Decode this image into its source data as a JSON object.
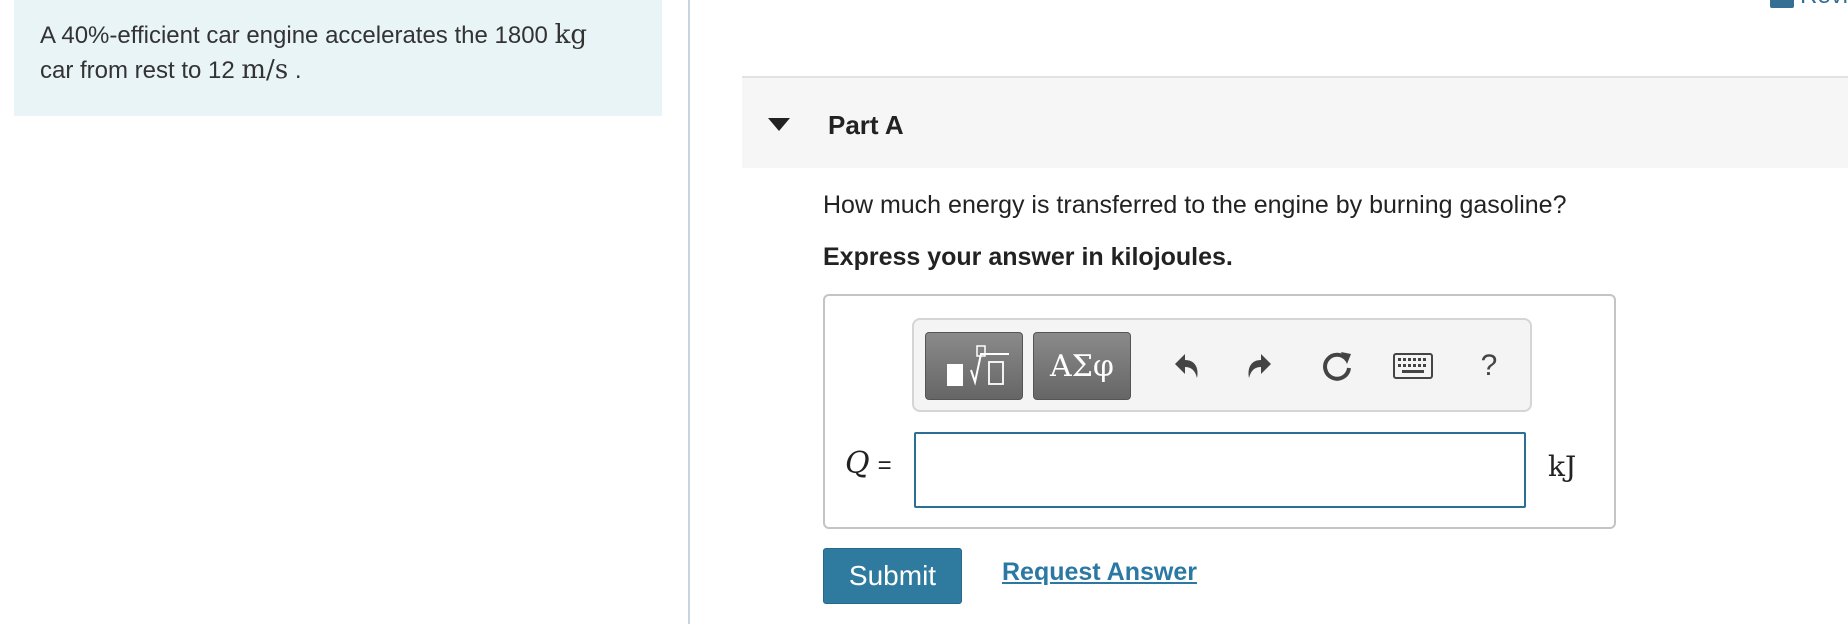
{
  "problem": {
    "text_1": "A 40%-efficient car engine accelerates the 1800 ",
    "mass_unit": "kg",
    "text_2": "car from rest to 12 ",
    "speed_unit": "m/s",
    "text_3": " ."
  },
  "header": {
    "review_label": "Revi"
  },
  "part": {
    "title": "Part A",
    "question": "How much energy is transferred to the engine by burning gasoline?",
    "instruction": "Express your answer in kilojoules."
  },
  "toolbar": {
    "templates_label": "templates",
    "greek_label": "ΑΣφ",
    "help_label": "?"
  },
  "answer": {
    "variable": "Q",
    "equals": "=",
    "value": "",
    "unit": "kJ"
  },
  "actions": {
    "submit_label": "Submit",
    "request_answer_label": "Request Answer"
  },
  "colors": {
    "problem_bg": "#e9f4f7",
    "accent": "#2f7ba0",
    "link": "#2a78a3"
  }
}
